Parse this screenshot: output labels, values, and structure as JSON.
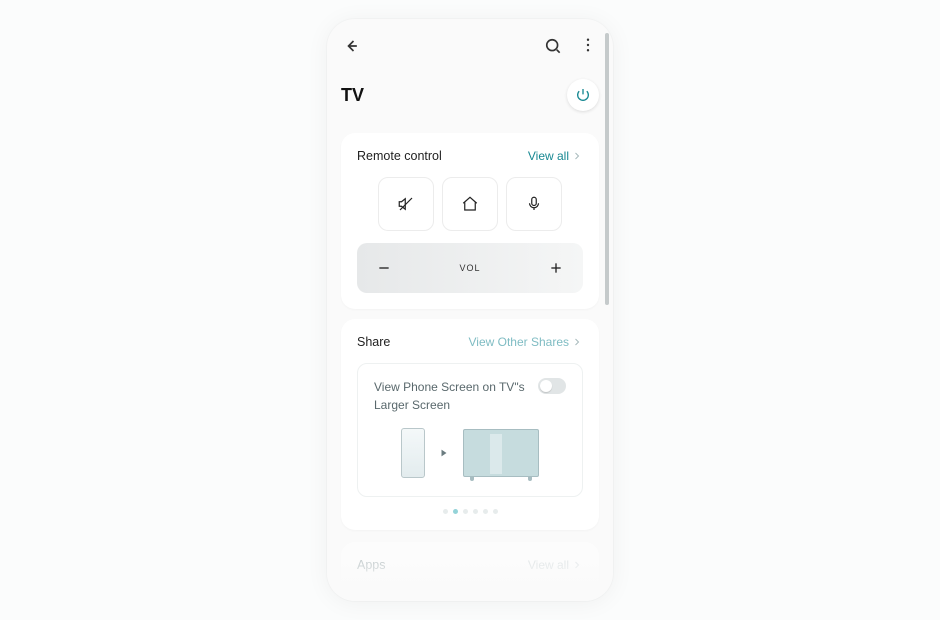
{
  "header": {
    "title": "TV"
  },
  "remote": {
    "title": "Remote control",
    "view_all": "View all",
    "vol_label": "VOL"
  },
  "share": {
    "title": "Share",
    "link": "View Other Shares",
    "cast_line1": "View Phone Screen on TV\"s",
    "cast_line2": "Larger Screen"
  },
  "apps": {
    "title": "Apps",
    "view_all": "View all"
  },
  "colors": {
    "teal": "#178892"
  }
}
